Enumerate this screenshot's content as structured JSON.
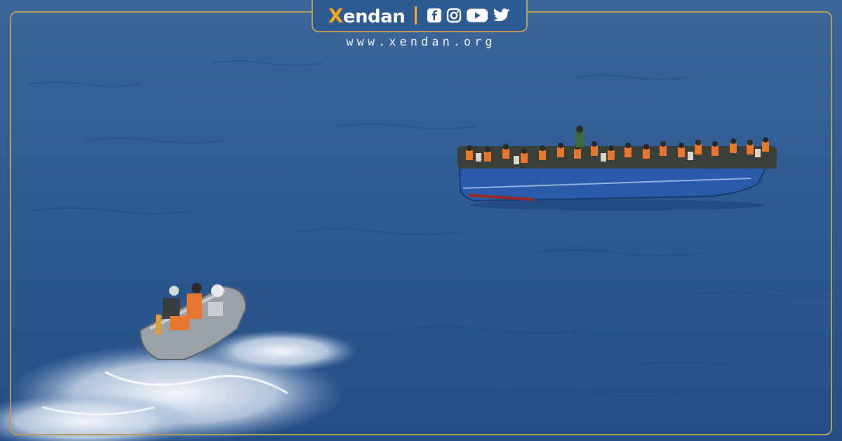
{
  "brand": {
    "logo_mark": "X",
    "logo_text": "endan",
    "website": "www.xendan.org",
    "accent_color": "#f4a71d",
    "frame_color": "#b89a5a"
  },
  "social_icons": [
    "facebook-icon",
    "instagram-icon",
    "youtube-icon",
    "twitter-icon"
  ],
  "photo": {
    "sea_color": "#2f5c93",
    "fishing_boat_color": "#2a5aa8",
    "life_vest_color": "#e8772e"
  }
}
